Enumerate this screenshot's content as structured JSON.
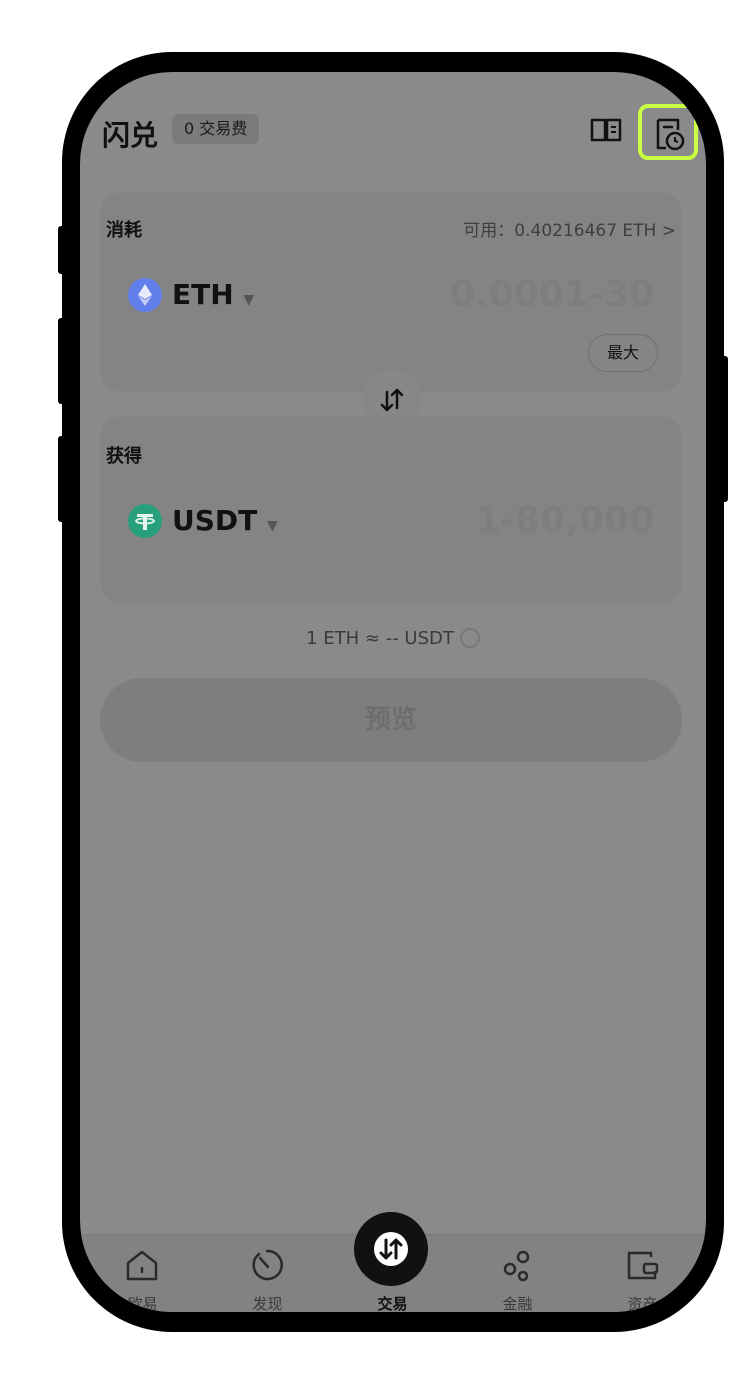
{
  "header": {
    "title": "闪兑",
    "fee_badge": "0 交易费"
  },
  "pay": {
    "label": "消耗",
    "available": "可用：0.40216467 ETH >",
    "token": "ETH",
    "amount_placeholder": "0.0001-30",
    "max_label": "最大"
  },
  "receive": {
    "label": "获得",
    "token": "USDT",
    "amount_placeholder": "1-80,000"
  },
  "rate": "1 ETH ≈ -- USDT",
  "preview_button": "预览",
  "tabs": [
    {
      "label": "欧易",
      "icon": "home-icon"
    },
    {
      "label": "发现",
      "icon": "discover-icon"
    },
    {
      "label": "交易",
      "icon": "trade-icon"
    },
    {
      "label": "金融",
      "icon": "finance-icon"
    },
    {
      "label": "资产",
      "icon": "wallet-icon"
    }
  ],
  "colors": {
    "highlight": "#c8ff40",
    "eth": "#627eea",
    "usdt": "#26a17b"
  }
}
